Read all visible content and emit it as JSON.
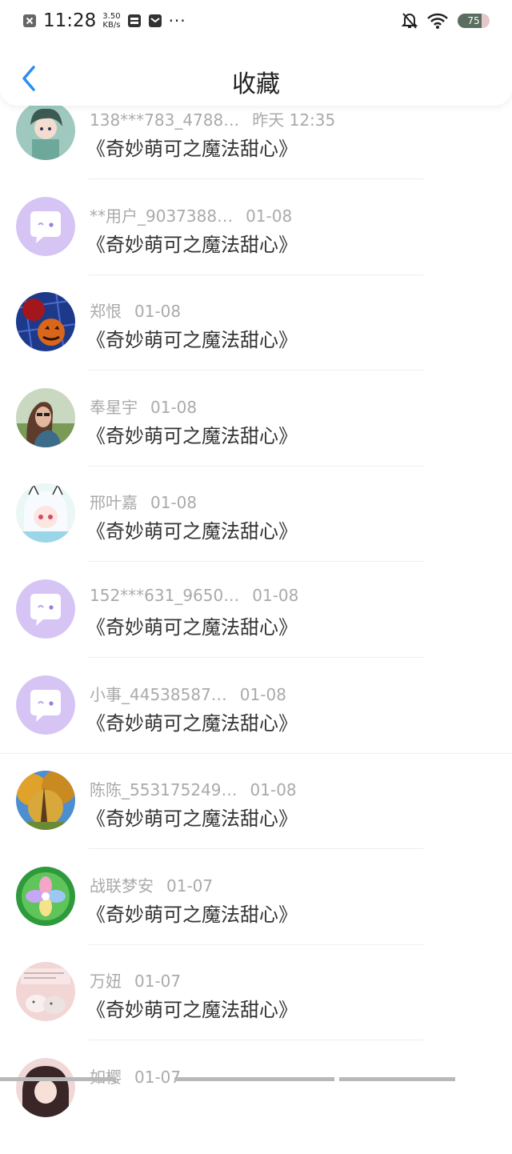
{
  "status": {
    "time": "11:28",
    "speed_value": "3.50",
    "speed_unit": "KB/s",
    "battery": "75",
    "battery_level": 0.75
  },
  "nav": {
    "title": "收藏",
    "back_icon": "chevron-left-icon",
    "accent": "#2b8ef0"
  },
  "items": [
    {
      "name": "138***783_4788…",
      "time": "昨天 12:35",
      "title": "《奇妙萌可之魔法甜心》",
      "avatar": "anime-girl"
    },
    {
      "name": "**用户_9037388…",
      "time": "01-08",
      "title": "《奇妙萌可之魔法甜心》",
      "avatar": "default"
    },
    {
      "name": "郑恨",
      "time": "01-08",
      "title": "《奇妙萌可之魔法甜心》",
      "avatar": "pumpkin"
    },
    {
      "name": "奉星宇",
      "time": "01-08",
      "title": "《奇妙萌可之魔法甜心》",
      "avatar": "woman-sunglasses"
    },
    {
      "name": "邢叶嘉",
      "time": "01-08",
      "title": "《奇妙萌可之魔法甜心》",
      "avatar": "anime-catgirl"
    },
    {
      "name": "152***631_9650…",
      "time": "01-08",
      "title": "《奇妙萌可之魔法甜心》",
      "avatar": "default"
    },
    {
      "name": "小事_44538587…",
      "time": "01-08",
      "title": "《奇妙萌可之魔法甜心》",
      "avatar": "default"
    },
    {
      "name": "陈陈_553175249…",
      "time": "01-08",
      "title": "《奇妙萌可之魔法甜心》",
      "avatar": "forest"
    },
    {
      "name": "战联梦安",
      "time": "01-07",
      "title": "《奇妙萌可之魔法甜心》",
      "avatar": "flower"
    },
    {
      "name": "万妞",
      "time": "01-07",
      "title": "《奇妙萌可之魔法甜心》",
      "avatar": "bunnies"
    },
    {
      "name": "如樱",
      "time": "01-07",
      "title": "",
      "avatar": "anime-girl-dark"
    }
  ]
}
